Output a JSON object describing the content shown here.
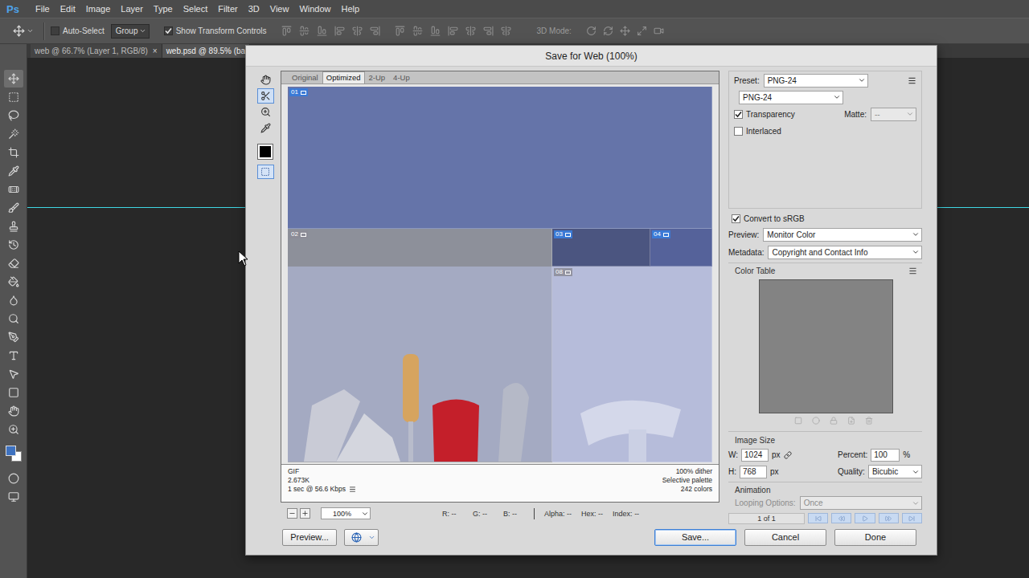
{
  "app": {
    "logo": "Ps"
  },
  "menu": [
    "File",
    "Edit",
    "Image",
    "Layer",
    "Type",
    "Select",
    "Filter",
    "3D",
    "View",
    "Window",
    "Help"
  ],
  "options_bar": {
    "auto_select": {
      "label": "Auto-Select",
      "checked": false
    },
    "group": "Group",
    "transform_controls": {
      "label": "Show Transform Controls",
      "checked": true
    },
    "mode_label": "3D Mode:"
  },
  "toolbar": [
    {
      "selected": true
    },
    {
      "selected": false
    },
    {
      "selected": false
    },
    {
      "selected": false
    },
    {
      "selected": false
    },
    {
      "selected": false
    },
    {
      "selected": false
    },
    {
      "selected": false
    },
    {
      "selected": false
    },
    {
      "selected": false
    },
    {
      "selected": false
    },
    {
      "selected": false
    },
    {
      "selected": false
    },
    {
      "selected": false
    },
    {
      "selected": false
    },
    {
      "selected": false
    },
    {
      "selected": false
    },
    {
      "selected": false
    },
    {
      "selected": false
    },
    {
      "selected": false
    }
  ],
  "doc_tabs": [
    {
      "label": "web @ 66.7% (Layer 1, RGB/8)",
      "close": "×",
      "selected": false
    },
    {
      "label": "web.psd @ 89.5% (ba",
      "close": "",
      "selected": true
    }
  ],
  "dialog": {
    "title": "Save for Web (100%)",
    "tools": [
      {
        "selected": false
      },
      {
        "selected": true
      },
      {
        "selected": false
      },
      {
        "selected": false
      }
    ],
    "slices_visible": true,
    "view_tabs": [
      {
        "label": "Original",
        "selected": false
      },
      {
        "label": "Optimized",
        "selected": true
      },
      {
        "label": "2-Up",
        "selected": false
      },
      {
        "label": "4-Up",
        "selected": false
      }
    ],
    "slices": [
      {
        "label": "01",
        "kind": "user"
      },
      {
        "label": "02",
        "kind": "auto"
      },
      {
        "label": "03",
        "kind": "user"
      },
      {
        "label": "04",
        "kind": "user"
      },
      {
        "label": "08",
        "kind": "auto"
      }
    ],
    "info_left": [
      "GIF",
      "2.673K",
      "1 sec @ 56.6 Kbps"
    ],
    "info_right": [
      "100% dither",
      "Selective palette",
      "242 colors"
    ],
    "zoom": "100%",
    "readouts": [
      {
        "label": "R:",
        "value": "--"
      },
      {
        "label": "G:",
        "value": "--"
      },
      {
        "label": "B:",
        "value": "--"
      },
      {
        "label": "Alpha:",
        "value": "--"
      },
      {
        "label": "Hex:",
        "value": "--"
      },
      {
        "label": "Index:",
        "value": "--"
      }
    ],
    "preset": {
      "label": "Preset:",
      "value": "PNG-24"
    },
    "format": "PNG-24",
    "transparency": {
      "label": "Transparency",
      "checked": true
    },
    "matte": {
      "label": "Matte:",
      "value": "--",
      "disabled": true
    },
    "interlaced": {
      "label": "Interlaced",
      "checked": false
    },
    "convert_srgb": {
      "label": "Convert to sRGB",
      "checked": true
    },
    "preview_setting": {
      "label": "Preview:",
      "value": "Monitor Color"
    },
    "metadata": {
      "label": "Metadata:",
      "value": "Copyright and Contact Info"
    },
    "color_table": {
      "title": "Color Table"
    },
    "image_size": {
      "title": "Image Size",
      "width": {
        "label": "W:",
        "value": "1024",
        "unit": "px"
      },
      "height": {
        "label": "H:",
        "value": "768",
        "unit": "px"
      },
      "percent": {
        "label": "Percent:",
        "value": "100",
        "unit": "%"
      },
      "quality": {
        "label": "Quality:",
        "value": "Bicubic"
      }
    },
    "animation": {
      "title": "Animation",
      "looping": {
        "label": "Looping Options:",
        "value": "Once",
        "disabled": true
      },
      "frame": "1 of 1"
    },
    "buttons": [
      {
        "label": "Preview...",
        "focused": false
      },
      {
        "label": "Save...",
        "focused": true
      },
      {
        "label": "Cancel",
        "focused": false
      },
      {
        "label": "Done",
        "focused": false
      }
    ]
  }
}
